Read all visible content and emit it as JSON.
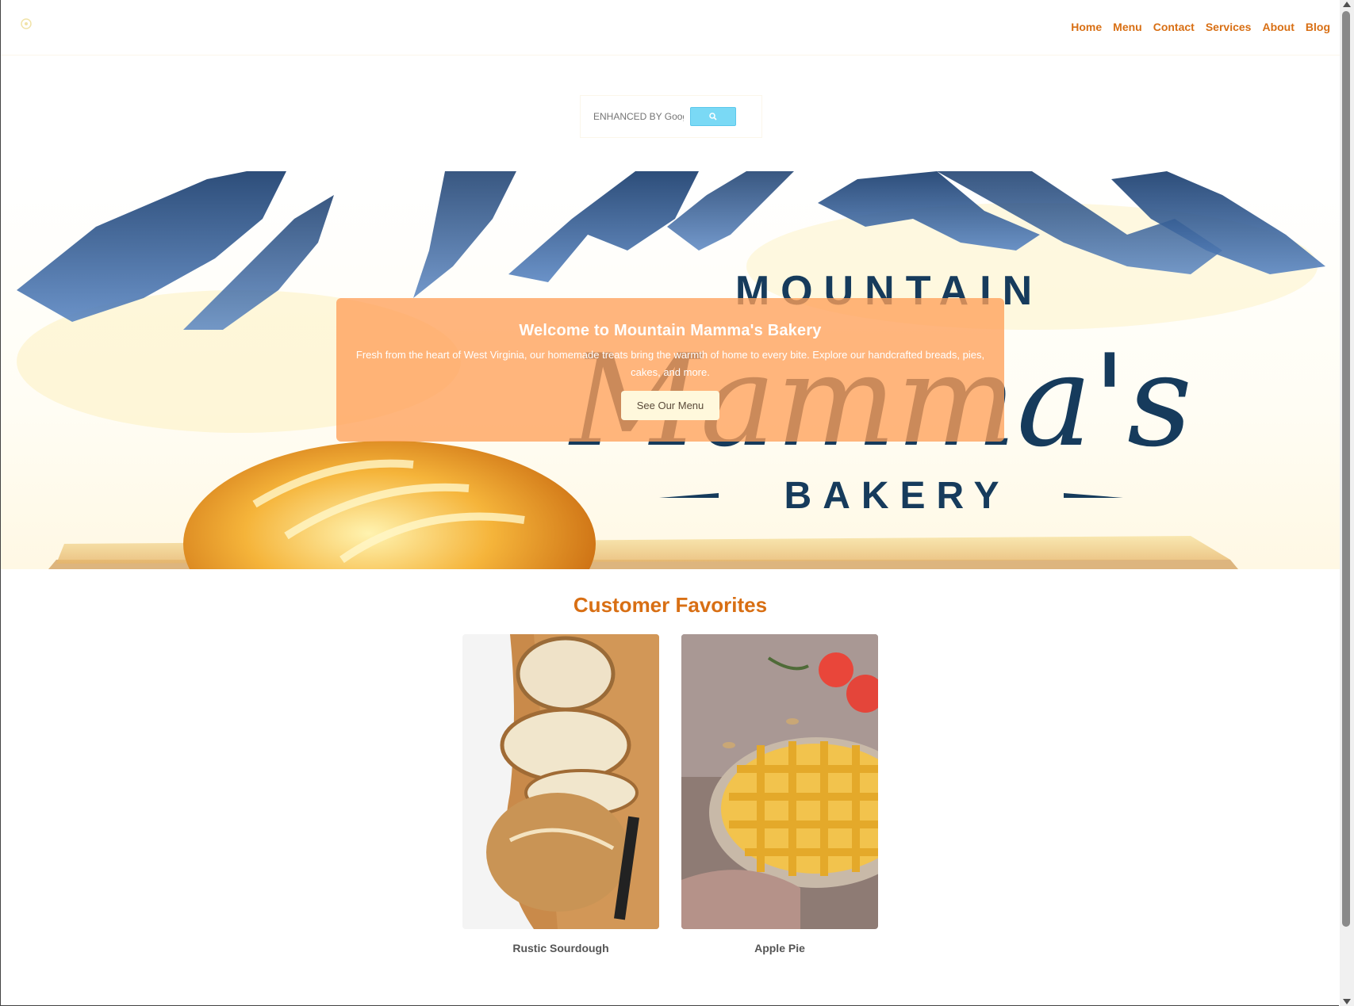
{
  "nav": {
    "items": [
      "Home",
      "Menu",
      "Contact",
      "Services",
      "About",
      "Blog"
    ]
  },
  "search": {
    "placeholder": "ENHANCED BY Google"
  },
  "hero": {
    "title": "Welcome to Mountain Mamma's Bakery",
    "subtitle": "Fresh from the heart of West Virginia, our homemade treats bring the warmth of home to every bite. Explore our handcrafted breads, pies, cakes, and more.",
    "button_label": "See Our Menu",
    "logo_text": {
      "top": "MOUNTAIN",
      "middle": "Mamma's",
      "bottom": "BAKERY"
    }
  },
  "favorites": {
    "heading": "Customer Favorites",
    "items": [
      {
        "label": "Rustic Sourdough"
      },
      {
        "label": "Apple Pie"
      }
    ]
  },
  "colors": {
    "accent": "#d86f14",
    "overlay": "#ffa05a",
    "mountain_blue": "#1e4a7e",
    "logo_navy": "#163b5c"
  }
}
